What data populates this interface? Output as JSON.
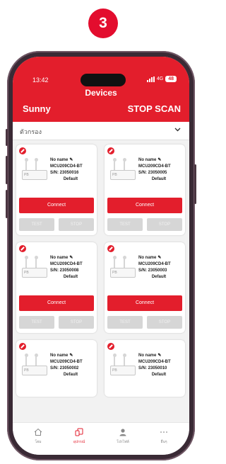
{
  "step": "3",
  "status_bar": {
    "time": "13:42",
    "network": "4G",
    "battery": "48"
  },
  "header": {
    "title": "Devices",
    "user_name": "Sunny",
    "stop_scan_label": "STOP SCAN"
  },
  "filter": {
    "label": "ตัวกรอง"
  },
  "devices": [
    {
      "name": "No name",
      "model": "MCU209CD4-BT",
      "serial": "S/N: 23050016",
      "profile": "Default",
      "connect_label": "Connect",
      "btn_left": "TEST",
      "btn_right": "STOP"
    },
    {
      "name": "No name",
      "model": "MCU209CD4-BT",
      "serial": "S/N: 23050005",
      "profile": "Default",
      "connect_label": "Connect",
      "btn_left": "TEST",
      "btn_right": "STOP"
    },
    {
      "name": "No name",
      "model": "MCU209CD4-BT",
      "serial": "S/N: 23050008",
      "profile": "Default",
      "connect_label": "Connect",
      "btn_left": "TEST",
      "btn_right": "STOP"
    },
    {
      "name": "No name",
      "model": "MCU209CD4-BT",
      "serial": "S/N: 23050003",
      "profile": "Default",
      "connect_label": "Connect",
      "btn_left": "TEST",
      "btn_right": "STOP"
    },
    {
      "name": "No name",
      "model": "MCU209CD4-BT",
      "serial": "S/N: 23050002",
      "profile": "Default"
    },
    {
      "name": "No name",
      "model": "MCU209CD4-BT",
      "serial": "S/N: 23050010",
      "profile": "Default"
    }
  ],
  "tabs": [
    {
      "label": "โฮม",
      "icon": "home-icon",
      "active": false
    },
    {
      "label": "อุปกรณ์",
      "icon": "devices-icon",
      "active": true
    },
    {
      "label": "โปรไฟล์",
      "icon": "profile-icon",
      "active": false
    },
    {
      "label": "อื่นๆ",
      "icon": "more-icon",
      "active": false
    }
  ],
  "colors": {
    "accent": "#e31e2c",
    "step_badge": "#e30d2e",
    "disabled": "#d6d6d6"
  }
}
